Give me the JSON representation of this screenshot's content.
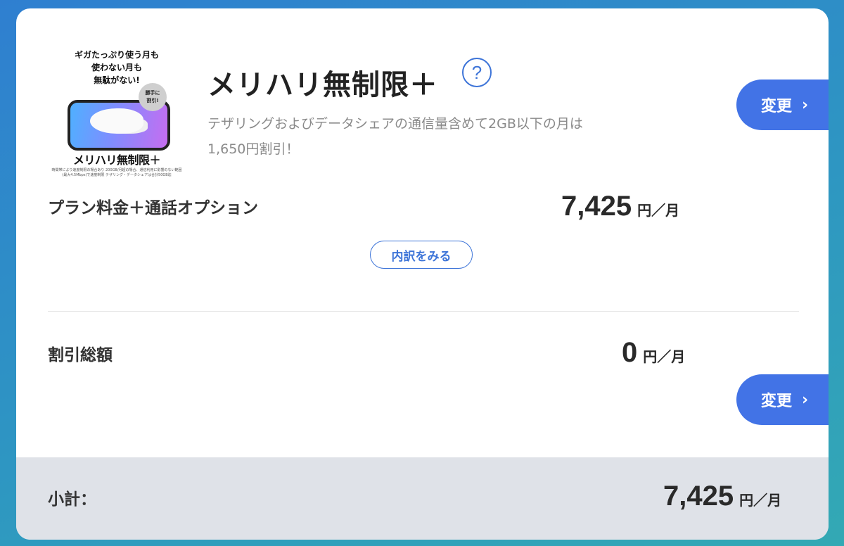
{
  "plan": {
    "promo_image": {
      "tagline": "ギガたっぷり使う月も\n使わない月も\n無駄がない!",
      "badge": "勝手に\n割引!",
      "name": "メリハリ無制限＋",
      "fine_print": "時間帯により速度制限の場合あり 200GB/月超の場合、通信利用に影響のない範囲(最大4.5Mbps)で速度制限 テザリング・データシェアは合計50GB迄"
    },
    "title": "メリハリ無制限＋",
    "help_icon": "question-circle-icon",
    "description": "テザリングおよびデータシェアの通信量含めて2GB以下の月は\n1,650円割引！",
    "change_label": "変更",
    "change_icon": "chevron-right-icon"
  },
  "plan_fee": {
    "label": "プラン料金＋通話オプション",
    "amount": "7,425",
    "unit": "円／月",
    "detail_button": "内訳をみる"
  },
  "discount": {
    "label": "割引総額",
    "amount": "0",
    "unit": "円／月",
    "change_label": "変更",
    "change_icon": "chevron-right-icon"
  },
  "subtotal": {
    "label": "小計：",
    "amount": "7,425",
    "unit": "円／月"
  },
  "colors": {
    "accent": "#4273e6",
    "subtotal_bg": "#dfe2e8",
    "background_start": "#2f7fd0",
    "background_end": "#33a9b4"
  }
}
